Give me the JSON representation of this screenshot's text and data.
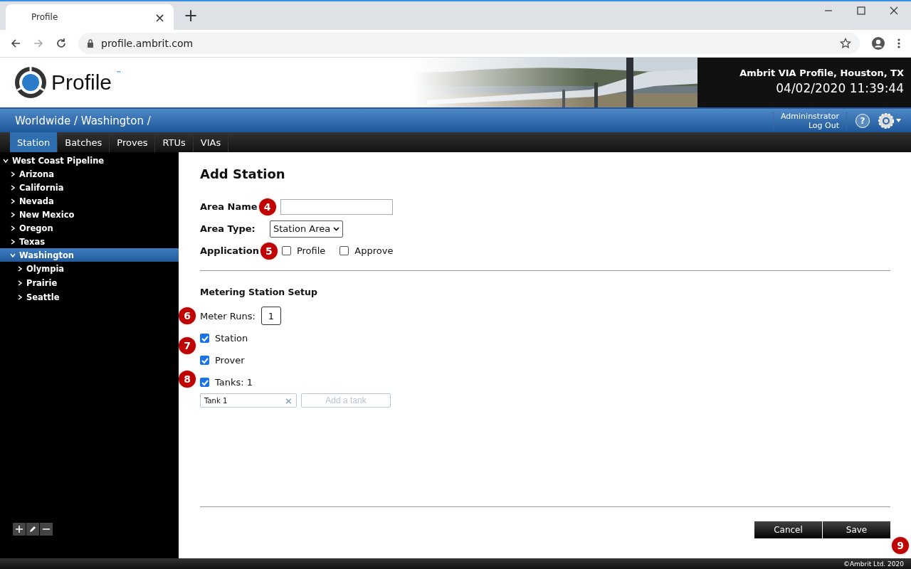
{
  "browser": {
    "tab": {
      "title": "Profile",
      "close": "×"
    },
    "new_tab": "+",
    "address": "profile.ambrit.com"
  },
  "header": {
    "logo": "Profile",
    "trademark": "™",
    "site": "Ambrit VIA Profile, Houston, TX",
    "datetime": "04/02/2020 11:39:44"
  },
  "nav_bar": {
    "breadcrumb": "Worldwide / Washington /",
    "user": "Admininstrator",
    "logout": "Log Out",
    "help": "?"
  },
  "tabs": [
    {
      "label": "Station",
      "selected": true
    },
    {
      "label": "Batches",
      "selected": false
    },
    {
      "label": "Proves",
      "selected": false
    },
    {
      "label": "RTUs",
      "selected": false
    },
    {
      "label": "VIAs",
      "selected": false
    }
  ],
  "tree": [
    {
      "label": "West Coast Pipeline",
      "expanded": true,
      "selected": false,
      "children": [
        {
          "label": "Arizona",
          "expanded": false,
          "selected": false
        },
        {
          "label": "California",
          "expanded": false,
          "selected": false
        },
        {
          "label": "Nevada",
          "expanded": false,
          "selected": false
        },
        {
          "label": "New Mexico",
          "expanded": false,
          "selected": false
        },
        {
          "label": "Oregon",
          "expanded": false,
          "selected": false
        },
        {
          "label": "Texas",
          "expanded": false,
          "selected": false
        },
        {
          "label": "Washington",
          "expanded": true,
          "selected": true,
          "children": [
            {
              "label": "Olympia",
              "expanded": false,
              "selected": false
            },
            {
              "label": "Prairie",
              "expanded": false,
              "selected": false
            },
            {
              "label": "Seattle",
              "expanded": false,
              "selected": false
            }
          ]
        }
      ]
    }
  ],
  "form": {
    "title": "Add Station",
    "area_name": {
      "label": "Area Name",
      "callout": "4"
    },
    "area_type": {
      "label": "Area Type:",
      "value": "Station Area"
    },
    "application": {
      "label": "Application",
      "callout": "5",
      "options": [
        {
          "label": "Profile",
          "checked": false
        },
        {
          "label": "Approve",
          "checked": false
        }
      ]
    },
    "section": "Metering Station Setup",
    "meter_runs": {
      "label": "Meter Runs:",
      "value": "1",
      "callout": "6"
    },
    "setup_options": [
      {
        "label": "Station",
        "checked": true
      },
      {
        "label": "Prover",
        "checked": true
      },
      {
        "label": "Tanks: 1",
        "checked": true
      }
    ],
    "setup_callouts": [
      "7",
      "8"
    ],
    "tanks": [
      {
        "label": "Tank 1",
        "remove": "×"
      }
    ],
    "add_tank_placeholder": "Add a tank",
    "buttons": [
      "Cancel",
      "Save"
    ],
    "save_callout": "9"
  },
  "footer": "©Ambrit Ltd. 2020"
}
